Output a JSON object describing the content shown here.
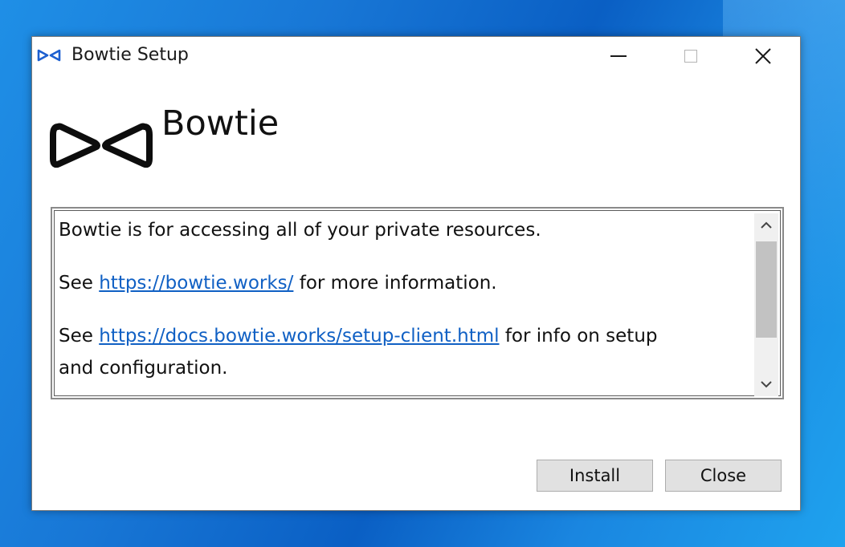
{
  "window": {
    "title": "Bowtie Setup",
    "close_glyph": "✕"
  },
  "header": {
    "app_name": "Bowtie",
    "logo_icon": "bowtie-logo-icon"
  },
  "info": {
    "line1": "Bowtie is for accessing all of your private resources.",
    "line2_prefix": "See ",
    "line2_link": "https://bowtie.works/",
    "line2_suffix": " for more information.",
    "line3_prefix": "See ",
    "line3_link": "https://docs.bowtie.works/setup-client.html",
    "line3_suffix": " for info on setup",
    "line4": "and configuration."
  },
  "scrollbar": {
    "up_glyph": "˄",
    "down_glyph": "˅"
  },
  "buttons": {
    "install_label": "Install",
    "close_label": "Close"
  },
  "colors": {
    "link": "#1060c4",
    "desktop": "#0a5fc4",
    "button_face": "#e1e1e1"
  }
}
